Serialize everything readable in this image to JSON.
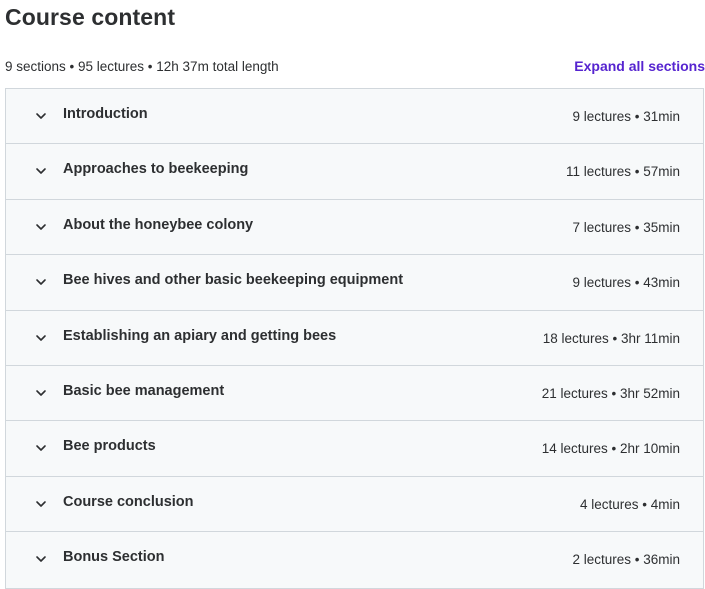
{
  "header": {
    "title": "Course content"
  },
  "summary": {
    "text": "9 sections • 95 lectures • 12h 37m total length",
    "expand_label": "Expand all sections"
  },
  "colors": {
    "accent": "#5624d0",
    "section_bg": "#f7f9fa",
    "border": "#d1d7dc",
    "text": "#2d2f31"
  },
  "sections": [
    {
      "title": "Introduction",
      "meta": "9 lectures • 31min",
      "icon": "chevron-down-icon"
    },
    {
      "title": "Approaches to beekeeping",
      "meta": "11 lectures • 57min",
      "icon": "chevron-down-icon"
    },
    {
      "title": "About the honeybee colony",
      "meta": "7 lectures • 35min",
      "icon": "chevron-down-icon"
    },
    {
      "title": "Bee hives and other basic beekeeping equipment",
      "meta": "9 lectures • 43min",
      "icon": "chevron-down-icon"
    },
    {
      "title": "Establishing an apiary and getting bees",
      "meta": "18 lectures • 3hr 11min",
      "icon": "chevron-down-icon"
    },
    {
      "title": "Basic bee management",
      "meta": "21 lectures • 3hr 52min",
      "icon": "chevron-down-icon"
    },
    {
      "title": "Bee products",
      "meta": "14 lectures • 2hr 10min",
      "icon": "chevron-down-icon"
    },
    {
      "title": "Course conclusion",
      "meta": "4 lectures • 4min",
      "icon": "chevron-down-icon"
    },
    {
      "title": "Bonus Section",
      "meta": "2 lectures • 36min",
      "icon": "chevron-down-icon"
    }
  ]
}
